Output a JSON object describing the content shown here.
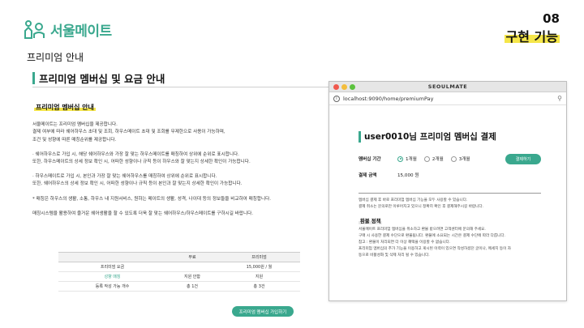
{
  "brand": {
    "name": "서울메이트",
    "mark_icon": "house-people-logo-icon",
    "color": "#3aa88e"
  },
  "page_subtitle": "프리미엄 안내",
  "badge": {
    "number": "08",
    "title": "구현 기능"
  },
  "section_title": "프리미엄 멤버십 및 요금 안내",
  "doc": {
    "heading": "프리미엄 멤버십 안내",
    "paragraphs": [
      "서울메이트는 프리미엄 멤버십을 제공합니다.",
      "결제 여부에 따라 쉐어하우스 초대 및 조회, 하우스메이트 초대 및 조회를 무제한으로 사용이 가능하며,",
      "조건 및 성향에 따른 매칭순위를 제공합니다.",
      "· 쉐어하우스로 가입 시, 해당 쉐어하우스와 가장 잘 맞는 하우스메이트를 매칭하여 상위에 순위로 표시합니다.",
      "또한, 하우스메이트의 상세 정보 확인 시, 어떠한 성향이나 규칙 등이 하우스와 잘 맞는지 상세한 확인이 가능합니다.",
      "· 하우스메이트로 가입 시, 본인과 가장 잘 맞는 쉐어하우스를 매칭하여 상위에 순위로 표시합니다.",
      "또한, 쉐어하우스의 상세 정보 확인 시, 어떠한 성향이나 규칙 등이 본인과 잘 맞는지 상세한 확인이 가능합니다.",
      "* 매칭은 하우스의 생활, 소통, 하우스 내 지원서비스, 원하는 메이트의 생활, 성격, 나이대 등의 정보들을 비교하여 매칭합니다.",
      "매칭시스템을 활용하여 즐거운 쉐어생활을 할 수 있도록 더욱 잘 맞는 쉐어하우스/하우스메이트를 구하시길 바랍니다."
    ]
  },
  "pricing_table": {
    "headers": [
      "",
      "무료",
      "프리미엄"
    ],
    "rows": [
      [
        "프리미엄 요금",
        "",
        "15,000원 / 월"
      ],
      [
        "성향 매칭",
        "지원 안함",
        "지원"
      ],
      [
        "등록 작성 가능 개수",
        "총 1건",
        "총 3건"
      ]
    ]
  },
  "join_button": "프리미엄 멤버십 가입하기",
  "browser": {
    "window_title": "SEOULMATE",
    "url": "localhost:9090/home/premiumPay",
    "info_icon": "info-icon",
    "zoom_icon": "magnifier-icon",
    "pay_title": "user0010님 프리미엄 멤버십 결제",
    "period_label": "멤버십 기간",
    "options": [
      "1개월",
      "2개월",
      "3개월"
    ],
    "selected_option": "1개월",
    "pay_button": "결제하기",
    "amount_label": "결제 금액",
    "amount_value": "15,000 원",
    "notice": [
      "멤버십 결제 후 바로 프리미엄 멤버십 기능을 모두 사용할 수 있습니다.",
      "결제 취소는 문의로만 이루어지고 있으니 정확히 확인 후 결제해주시길 바랍니다."
    ],
    "refund_title": "환불 정책",
    "refund": [
      "서울메이트 프리미엄 멤버십을 취소하고 환불 받으려면 고객센터에 문의해 주세요.",
      "구매 시 사용한 결제 수단으로 환불됩니다. 환불에 소요되는 시간은 결제 수단에 따라 다릅니다.",
      "참고 : 환불이 처리되면 더 이상 혜택을 이용할 수 없습니다.",
      "프리미엄 멤버십의 추가 기능을 이용하고 게시된 이력이 있으면 작성하셨던 글이나, 메세지 등이 자",
      "동으로 비활성화 및 삭제 처리 될 수 있습니다."
    ]
  }
}
